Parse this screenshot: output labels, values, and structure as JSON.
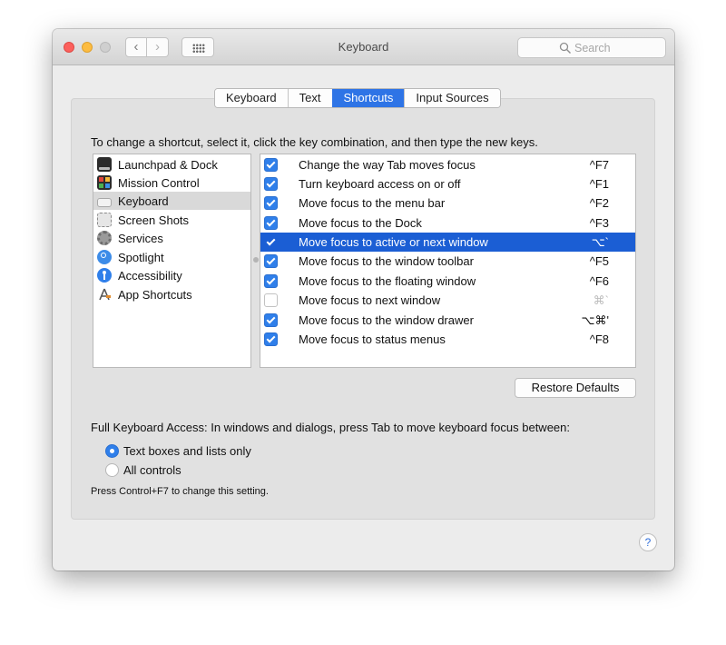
{
  "window": {
    "title": "Keyboard"
  },
  "toolbar": {
    "back_glyph": "‹",
    "forward_glyph": "›",
    "grid_icon": "show-all-grid-icon"
  },
  "search": {
    "placeholder": "Search",
    "icon": "search-icon"
  },
  "tabs": [
    {
      "label": "Keyboard",
      "active": false
    },
    {
      "label": "Text",
      "active": false
    },
    {
      "label": "Shortcuts",
      "active": true
    },
    {
      "label": "Input Sources",
      "active": false
    }
  ],
  "instructions": "To change a shortcut, select it, click the key combination, and then type the new keys.",
  "categories": [
    {
      "label": "Launchpad & Dock",
      "icon": "launchpad-dock-icon"
    },
    {
      "label": "Mission Control",
      "icon": "mission-control-icon"
    },
    {
      "label": "Keyboard",
      "icon": "keyboard-icon",
      "selected": true
    },
    {
      "label": "Screen Shots",
      "icon": "screenshots-icon"
    },
    {
      "label": "Services",
      "icon": "services-gear-icon"
    },
    {
      "label": "Spotlight",
      "icon": "spotlight-icon"
    },
    {
      "label": "Accessibility",
      "icon": "accessibility-icon"
    },
    {
      "label": "App Shortcuts",
      "icon": "app-shortcuts-icon"
    }
  ],
  "shortcuts": [
    {
      "label": "Change the way Tab moves focus",
      "key": "^F7",
      "checked": true
    },
    {
      "label": "Turn keyboard access on or off",
      "key": "^F1",
      "checked": true
    },
    {
      "label": "Move focus to the menu bar",
      "key": "^F2",
      "checked": true
    },
    {
      "label": "Move focus to the Dock",
      "key": "^F3",
      "checked": true
    },
    {
      "label": "Move focus to active or next window",
      "key": "⌥`",
      "checked": true,
      "selected": true
    },
    {
      "label": "Move focus to the window toolbar",
      "key": "^F5",
      "checked": true
    },
    {
      "label": "Move focus to the floating window",
      "key": "^F6",
      "checked": true
    },
    {
      "label": "Move focus to next window",
      "key": "⌘`",
      "checked": false
    },
    {
      "label": "Move focus to the window drawer",
      "key": "⌥⌘'",
      "checked": true
    },
    {
      "label": "Move focus to status menus",
      "key": "^F8",
      "checked": true
    }
  ],
  "restore_label": "Restore Defaults",
  "full_keyboard_access": {
    "label": "Full Keyboard Access: In windows and dialogs, press Tab to move keyboard focus between:",
    "options": [
      {
        "label": "Text boxes and lists only",
        "selected": true
      },
      {
        "label": "All controls",
        "selected": false
      }
    ],
    "hint": "Press Control+F7 to change this setting."
  },
  "help_label": "?",
  "colors": {
    "accent": "#2e74e6",
    "selection": "#1b5ed4"
  }
}
